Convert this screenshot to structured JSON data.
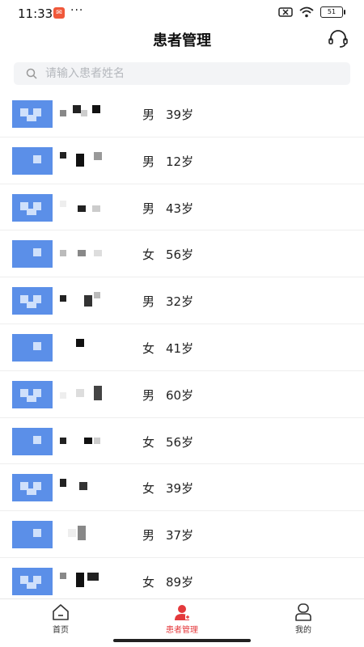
{
  "status_bar": {
    "time": "11:33",
    "battery": "51"
  },
  "header": {
    "title": "患者管理"
  },
  "search": {
    "placeholder": "请输入患者姓名"
  },
  "patients": [
    {
      "gender": "男",
      "age": "39岁"
    },
    {
      "gender": "男",
      "age": "12岁"
    },
    {
      "gender": "男",
      "age": "43岁"
    },
    {
      "gender": "女",
      "age": "56岁"
    },
    {
      "gender": "男",
      "age": "32岁"
    },
    {
      "gender": "女",
      "age": "41岁"
    },
    {
      "gender": "男",
      "age": "60岁"
    },
    {
      "gender": "女",
      "age": "56岁"
    },
    {
      "gender": "女",
      "age": "39岁"
    },
    {
      "gender": "男",
      "age": "37岁"
    },
    {
      "gender": "女",
      "age": "89岁"
    }
  ],
  "tabbar": {
    "home": "首页",
    "patients": "患者管理",
    "mine": "我的"
  },
  "colors": {
    "active": "#e4393c",
    "avatar": "#5b8fe8"
  }
}
